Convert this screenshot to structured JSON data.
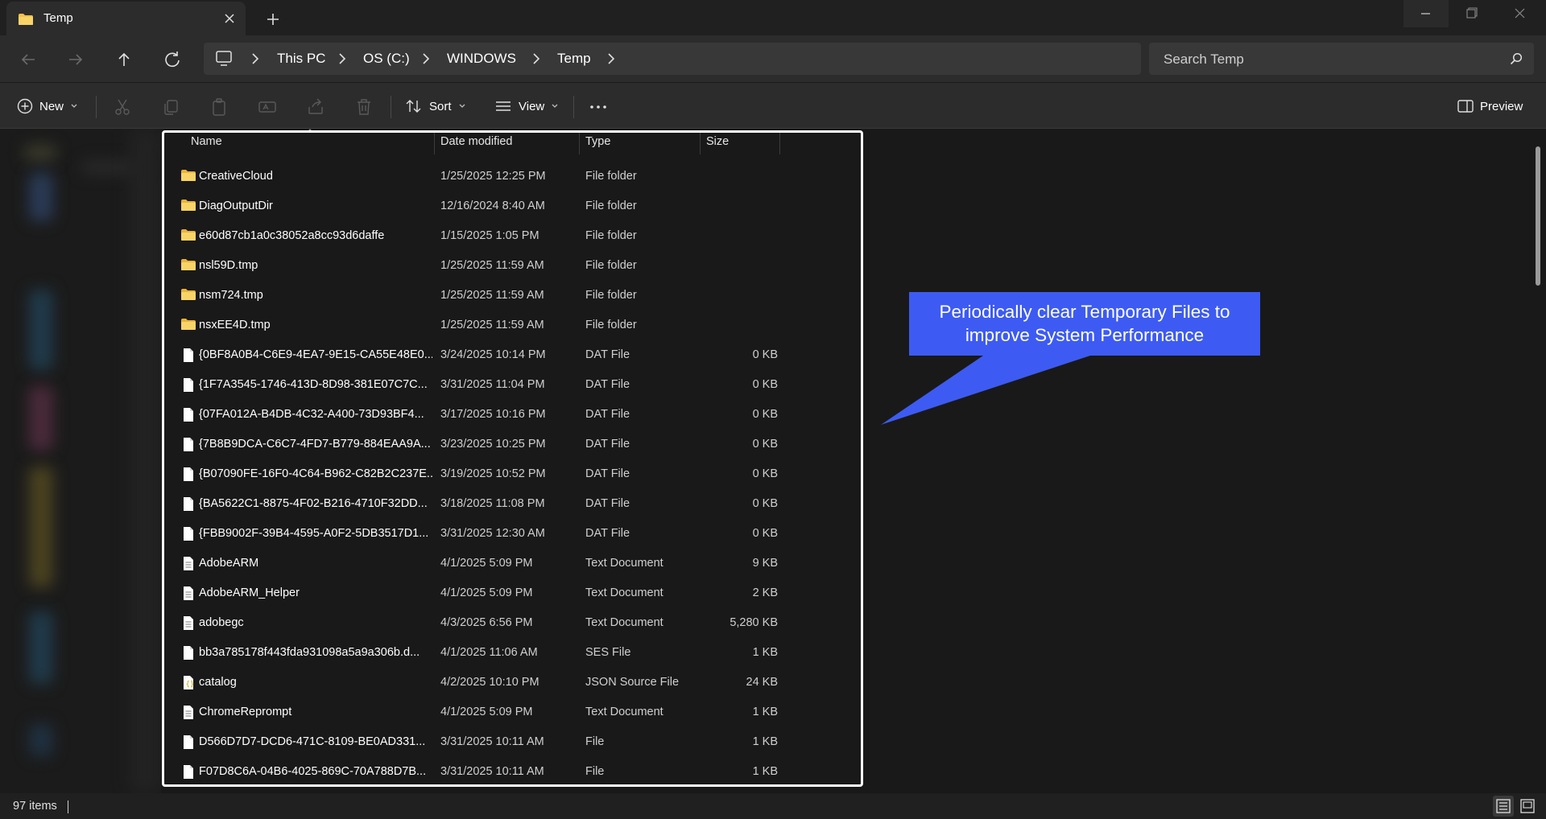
{
  "window": {
    "tab_title": "Temp"
  },
  "address": {
    "crumbs": [
      "This PC",
      "OS (C:)",
      "WINDOWS",
      "Temp"
    ]
  },
  "search": {
    "placeholder": "Search Temp"
  },
  "commands": {
    "new_label": "New",
    "sort_label": "Sort",
    "view_label": "View",
    "preview_label": "Preview"
  },
  "columns": {
    "name": "Name",
    "date": "Date modified",
    "type": "Type",
    "size": "Size"
  },
  "files": [
    {
      "name": "CreativeCloud",
      "date": "1/25/2025 12:25 PM",
      "type": "File folder",
      "size": "",
      "icon": "folder-icon"
    },
    {
      "name": "DiagOutputDir",
      "date": "12/16/2024 8:40 AM",
      "type": "File folder",
      "size": "",
      "icon": "folder-icon"
    },
    {
      "name": "e60d87cb1a0c38052a8cc93d6daffe",
      "date": "1/15/2025 1:05 PM",
      "type": "File folder",
      "size": "",
      "icon": "folder-icon"
    },
    {
      "name": "nsl59D.tmp",
      "date": "1/25/2025 11:59 AM",
      "type": "File folder",
      "size": "",
      "icon": "folder-icon"
    },
    {
      "name": "nsm724.tmp",
      "date": "1/25/2025 11:59 AM",
      "type": "File folder",
      "size": "",
      "icon": "folder-icon"
    },
    {
      "name": "nsxEE4D.tmp",
      "date": "1/25/2025 11:59 AM",
      "type": "File folder",
      "size": "",
      "icon": "folder-icon"
    },
    {
      "name": "{0BF8A0B4-C6E9-4EA7-9E15-CA55E48E0...",
      "date": "3/24/2025 10:14 PM",
      "type": "DAT File",
      "size": "0 KB",
      "icon": "file-icon"
    },
    {
      "name": "{1F7A3545-1746-413D-8D98-381E07C7C...",
      "date": "3/31/2025 11:04 PM",
      "type": "DAT File",
      "size": "0 KB",
      "icon": "file-icon"
    },
    {
      "name": "{07FA012A-B4DB-4C32-A400-73D93BF4...",
      "date": "3/17/2025 10:16 PM",
      "type": "DAT File",
      "size": "0 KB",
      "icon": "file-icon"
    },
    {
      "name": "{7B8B9DCA-C6C7-4FD7-B779-884EAA9A...",
      "date": "3/23/2025 10:25 PM",
      "type": "DAT File",
      "size": "0 KB",
      "icon": "file-icon"
    },
    {
      "name": "{B07090FE-16F0-4C64-B962-C82B2C237E...",
      "date": "3/19/2025 10:52 PM",
      "type": "DAT File",
      "size": "0 KB",
      "icon": "file-icon"
    },
    {
      "name": "{BA5622C1-8875-4F02-B216-4710F32DD...",
      "date": "3/18/2025 11:08 PM",
      "type": "DAT File",
      "size": "0 KB",
      "icon": "file-icon"
    },
    {
      "name": "{FBB9002F-39B4-4595-A0F2-5DB3517D1...",
      "date": "3/31/2025 12:30 AM",
      "type": "DAT File",
      "size": "0 KB",
      "icon": "file-icon"
    },
    {
      "name": "AdobeARM",
      "date": "4/1/2025 5:09 PM",
      "type": "Text Document",
      "size": "9 KB",
      "icon": "text-file-icon"
    },
    {
      "name": "AdobeARM_Helper",
      "date": "4/1/2025 5:09 PM",
      "type": "Text Document",
      "size": "2 KB",
      "icon": "text-file-icon"
    },
    {
      "name": "adobegc",
      "date": "4/3/2025 6:56 PM",
      "type": "Text Document",
      "size": "5,280 KB",
      "icon": "text-file-icon"
    },
    {
      "name": "bb3a785178f443fda931098a5a9a306b.d...",
      "date": "4/1/2025 11:06 AM",
      "type": "SES File",
      "size": "1 KB",
      "icon": "file-icon"
    },
    {
      "name": "catalog",
      "date": "4/2/2025 10:10 PM",
      "type": "JSON Source File",
      "size": "24 KB",
      "icon": "json-file-icon"
    },
    {
      "name": "ChromeReprompt",
      "date": "4/1/2025 5:09 PM",
      "type": "Text Document",
      "size": "1 KB",
      "icon": "text-file-icon"
    },
    {
      "name": "D566D7D7-DCD6-471C-8109-BE0AD331...",
      "date": "3/31/2025 10:11 AM",
      "type": "File",
      "size": "1 KB",
      "icon": "file-icon"
    },
    {
      "name": "F07D8C6A-04B6-4025-869C-70A788D7B...",
      "date": "3/31/2025 10:11 AM",
      "type": "File",
      "size": "1 KB",
      "icon": "file-icon"
    }
  ],
  "callout": {
    "line1": "Periodically clear Temporary Files to",
    "line2": "improve System Performance"
  },
  "status": {
    "item_count": "97 items"
  },
  "colors": {
    "accent_callout": "#3d5bf2",
    "folder_yellow": "#f4c247",
    "background": "#191919"
  }
}
